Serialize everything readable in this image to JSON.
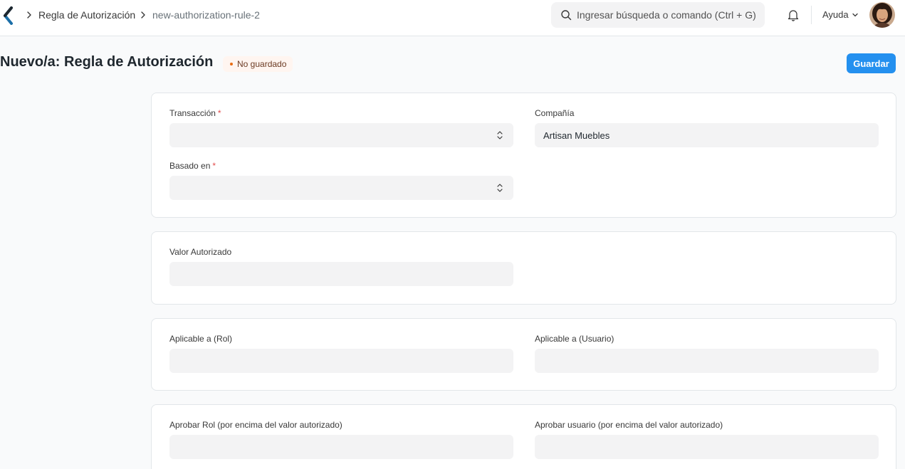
{
  "navbar": {
    "breadcrumbs": [
      "Regla de Autorización",
      "new-authorization-rule-2"
    ],
    "search": {
      "placeholder": "Ingresar búsqueda o comando (Ctrl + G)",
      "value": ""
    },
    "help_label": "Ayuda",
    "icons": [
      "app-logo-icon",
      "chevron-right-icon",
      "search-icon",
      "bell-icon",
      "chevron-down-icon",
      "user-avatar"
    ]
  },
  "page": {
    "title": "Nuevo/a: Regla de Autorización",
    "status": "No guardado",
    "save_label": "Guardar"
  },
  "form": {
    "transaction": {
      "label": "Transacción",
      "required": "*",
      "value": ""
    },
    "company": {
      "label": "Compañía",
      "value": "Artisan Muebles"
    },
    "based_on": {
      "label": "Basado en",
      "required": "*",
      "value": ""
    },
    "value": {
      "label": "Valor Autorizado",
      "value": ""
    },
    "applicable_role": {
      "label": "Aplicable a (Rol)",
      "value": ""
    },
    "applicable_user": {
      "label": "Aplicable a (Usuario)",
      "value": ""
    },
    "approving_role": {
      "label": "Aprobar Rol (por encima del valor autorizado)",
      "value": ""
    },
    "approving_user": {
      "label": "Aprobar usuario (por encima del valor autorizado)",
      "value": ""
    }
  },
  "colors": {
    "primary": "#2490ef",
    "control_bg": "#f3f3f4",
    "required": "#e24c4c",
    "status_dot": "#e86c13"
  }
}
